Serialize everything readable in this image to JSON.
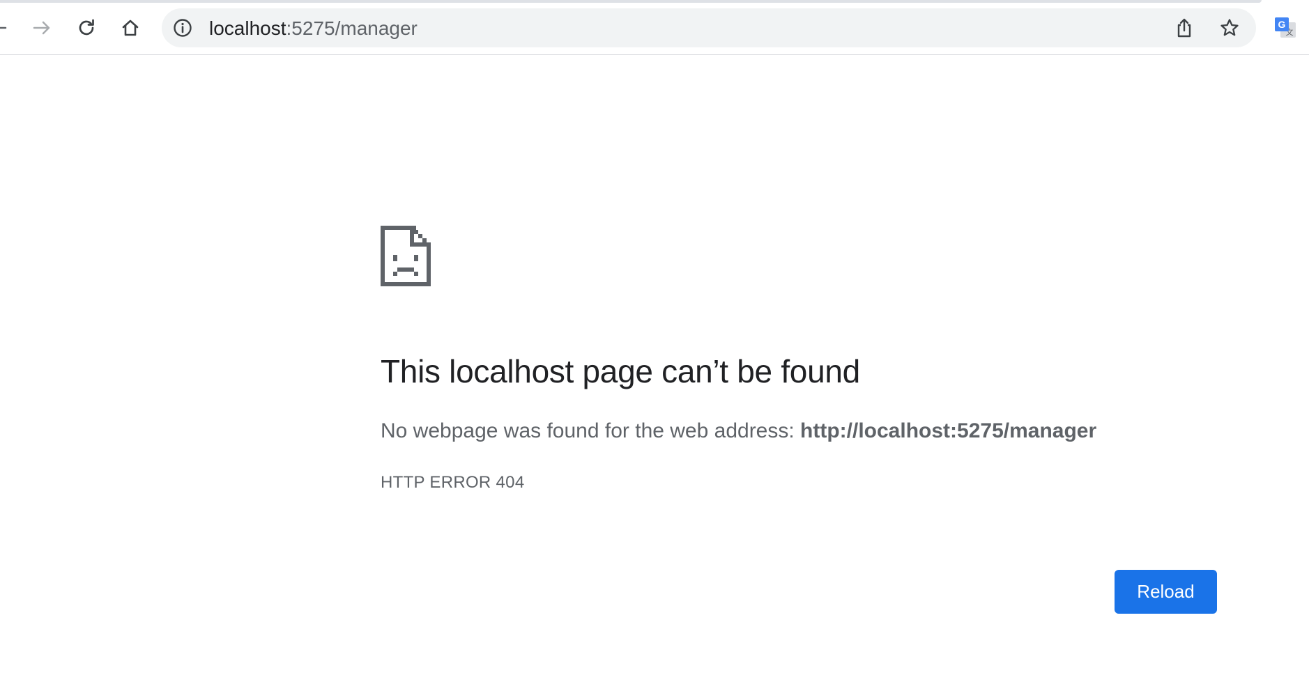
{
  "browser": {
    "address_bar": {
      "url_host": "localhost",
      "url_path": ":5275/manager"
    },
    "icons": {
      "back": "back-arrow-icon",
      "forward": "forward-arrow-icon",
      "reload": "reload-icon",
      "home": "home-icon",
      "site_info": "info-icon",
      "share": "share-icon",
      "bookmark": "star-icon",
      "extension": "google-translate-icon"
    }
  },
  "error_page": {
    "icon": "sad-page-icon",
    "title": "This localhost page can’t be found",
    "description_prefix": "No webpage was found for the web address: ",
    "description_url": "http://localhost:5275/manager",
    "error_code": "HTTP ERROR 404",
    "reload_label": "Reload"
  },
  "colors": {
    "accent": "#1a73e8",
    "text_primary": "#202124",
    "text_secondary": "#5f6368",
    "omnibox_bg": "#f1f3f4"
  }
}
